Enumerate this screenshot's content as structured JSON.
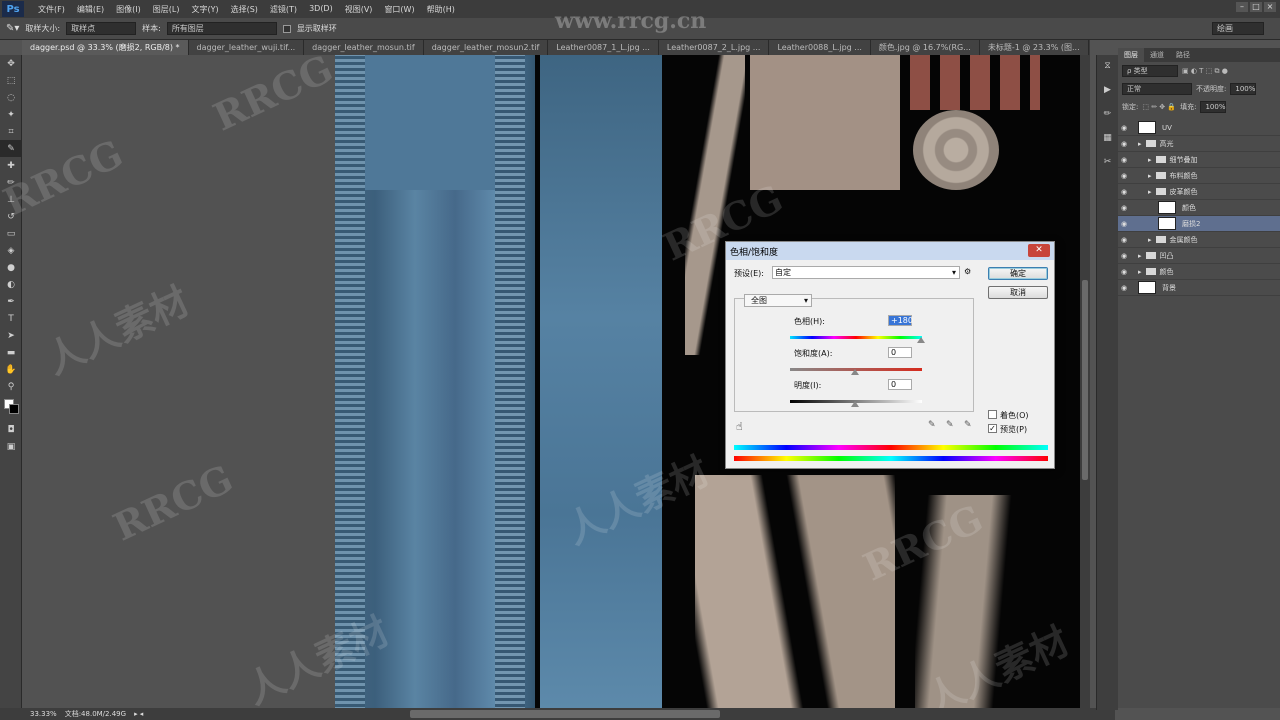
{
  "app": {
    "logo": "Ps"
  },
  "menu": [
    "文件(F)",
    "编辑(E)",
    "图像(I)",
    "图层(L)",
    "文字(Y)",
    "选择(S)",
    "滤镜(T)",
    "3D(D)",
    "视图(V)",
    "窗口(W)",
    "帮助(H)"
  ],
  "options": {
    "sample_size_label": "取样大小:",
    "sample_size_value": "取样点",
    "sample_label": "样本:",
    "sample_value": "所有图层",
    "show_ring_label": "显示取样环",
    "workspace": "绘画"
  },
  "tabs": [
    "dagger.psd @ 33.3% (磨损2, RGB/8) *",
    "dagger_leather_wuji.tif...",
    "dagger_leather_mosun.tif",
    "dagger_leather_mosun2.tif",
    "Leather0087_1_L.jpg ...",
    "Leather0087_2_L.jpg ...",
    "Leather0088_L.jpg ...",
    "颜色.jpg @ 16.7%(RG...",
    "未标题-1 @ 23.3% (图..."
  ],
  "status": {
    "zoom": "33.33%",
    "doc": "文档:48.0M/2.49G"
  },
  "panel": {
    "tabs": [
      "图层",
      "通道",
      "路径"
    ],
    "filter": "ρ 类型",
    "blend": "正常",
    "opacity_label": "不透明度:",
    "opacity": "100%",
    "lock_label": "锁定:",
    "fill_label": "填充:",
    "fill": "100%",
    "layers": [
      {
        "name": "UV",
        "kind": "layer",
        "indent": 0
      },
      {
        "name": "高光",
        "kind": "group",
        "indent": 0
      },
      {
        "name": "细节叠加",
        "kind": "group",
        "indent": 1
      },
      {
        "name": "布料颜色",
        "kind": "group",
        "indent": 1
      },
      {
        "name": "皮革颜色",
        "kind": "group",
        "indent": 1
      },
      {
        "name": "颜色",
        "kind": "layer",
        "indent": 2
      },
      {
        "name": "磨损2",
        "kind": "layer",
        "indent": 2,
        "selected": true
      },
      {
        "name": "金属颜色",
        "kind": "group",
        "indent": 1
      },
      {
        "name": "凹凸",
        "kind": "group",
        "indent": 0
      },
      {
        "name": "颜色",
        "kind": "group",
        "indent": 0
      },
      {
        "name": "背景",
        "kind": "layer",
        "indent": 0
      }
    ]
  },
  "dialog": {
    "title": "色相/饱和度",
    "preset_label": "预设(E):",
    "preset_value": "自定",
    "ok": "确定",
    "cancel": "取消",
    "channel": "全图",
    "hue_label": "色相(H):",
    "hue_value": "+180",
    "sat_label": "饱和度(A):",
    "sat_value": "0",
    "light_label": "明度(I):",
    "light_value": "0",
    "colorize_label": "着色(O)",
    "preview_label": "预览(P)",
    "preview_checked": "✓"
  },
  "watermarks": [
    "www.rrcg.cn",
    "RRCG",
    "人人素材",
    "RRCG",
    "人人素材",
    "RRCG",
    "人人素材",
    "RRCG",
    "人人素材",
    "RRCG",
    "人人素材",
    "RRCG"
  ],
  "colors": {
    "accent": "#5f6f8f",
    "dialog_title": "#c9d9ef",
    "close": "#c8453a"
  }
}
